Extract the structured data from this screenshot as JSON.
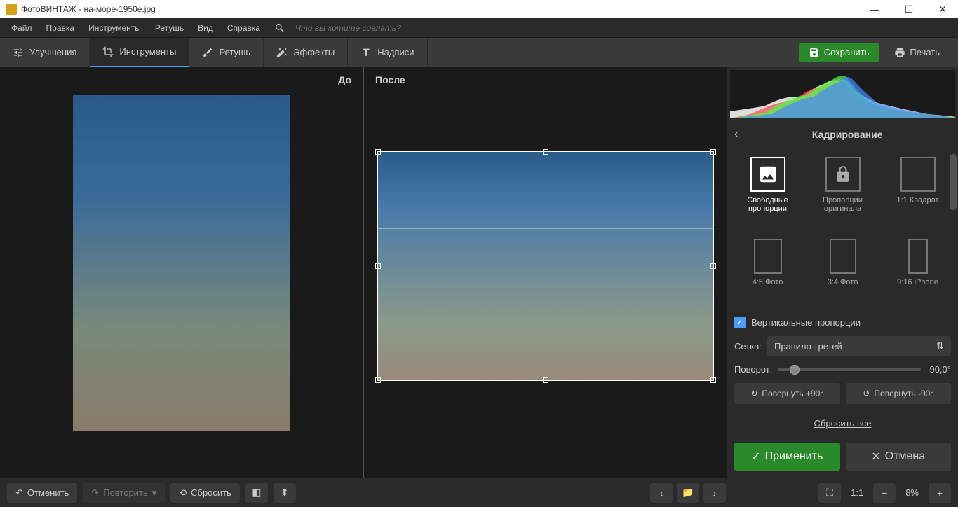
{
  "app": {
    "title": "ФотоВИНТАЖ - на-море-1950е.jpg"
  },
  "menu": {
    "file": "Файл",
    "edit": "Правка",
    "tools": "Инструменты",
    "retouch": "Ретушь",
    "view": "Вид",
    "help": "Справка",
    "search_placeholder": "Что вы хотите сделать?"
  },
  "tabs": {
    "enhance": "Улучшения",
    "tools": "Инструменты",
    "retouch": "Ретушь",
    "effects": "Эффекты",
    "text": "Надписи"
  },
  "actions": {
    "save": "Сохранить",
    "print": "Печать"
  },
  "preview": {
    "before": "До",
    "after": "После"
  },
  "panel": {
    "title": "Кадрирование",
    "presets": [
      {
        "label": "Свободные пропорции"
      },
      {
        "label": "Пропорции оригинала"
      },
      {
        "label": "1:1 Квадрат"
      },
      {
        "label": "4:5 Фото"
      },
      {
        "label": "3:4 Фото"
      },
      {
        "label": "9:16 iPhone"
      }
    ],
    "vertical_checkbox": "Вертикальные пропорции",
    "grid_label": "Сетка:",
    "grid_value": "Правило третей",
    "rotate_label": "Поворот:",
    "rotate_value": "-90,0°",
    "rotate_plus": "Повернуть +90°",
    "rotate_minus": "Повернуть -90°",
    "reset": "Сбросить все",
    "apply": "Применить",
    "cancel": "Отмена"
  },
  "bottom": {
    "undo": "Отменить",
    "redo": "Повторить",
    "reset": "Сбросить",
    "zoom_ratio": "1:1",
    "zoom_pct": "8%"
  }
}
